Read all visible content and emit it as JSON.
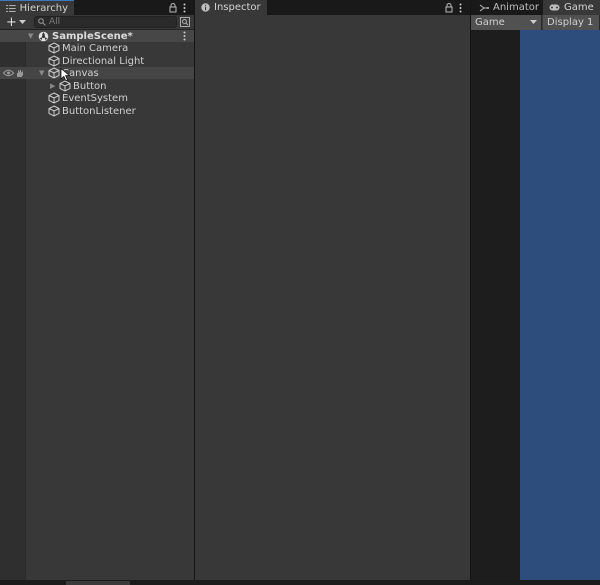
{
  "hierarchy": {
    "tab_label": "Hierarchy",
    "add_label": "+",
    "search_placeholder": "All",
    "scene": "SampleScene*",
    "items": [
      {
        "label": "Main Camera"
      },
      {
        "label": "Directional Light"
      },
      {
        "label": "Canvas"
      },
      {
        "label": "Button"
      },
      {
        "label": "EventSystem"
      },
      {
        "label": "ButtonListener"
      }
    ]
  },
  "inspector": {
    "tab_label": "Inspector"
  },
  "animator": {
    "tab_label": "Animator"
  },
  "game": {
    "tab_label": "Game",
    "view_dropdown": "Game",
    "display_dropdown": "Display 1"
  },
  "colors": {
    "accent": "#3a79bb",
    "viewport": "#2d4d7c"
  }
}
